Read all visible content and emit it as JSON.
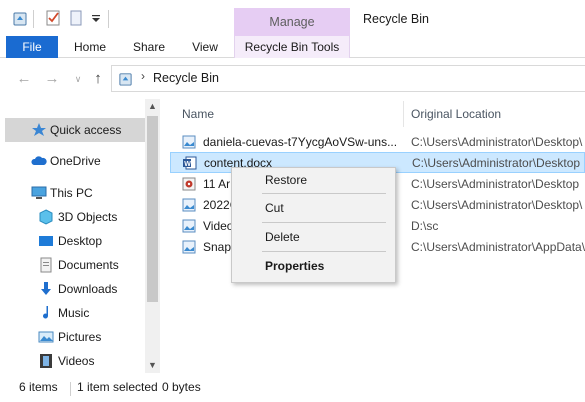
{
  "window": {
    "title": "Recycle Bin",
    "contextual_tab_group": "Manage"
  },
  "ribbon": {
    "tabs": [
      "File",
      "Home",
      "Share",
      "View",
      "Recycle Bin Tools"
    ]
  },
  "address": {
    "location": "Recycle Bin"
  },
  "nav_pane": {
    "items": [
      "Quick access",
      "OneDrive",
      "This PC",
      "3D Objects",
      "Desktop",
      "Documents",
      "Downloads",
      "Music",
      "Pictures",
      "Videos"
    ]
  },
  "columns": {
    "name": "Name",
    "original_location": "Original Location"
  },
  "files": [
    {
      "name": "daniela-cuevas-t7YycgAoVSw-uns...",
      "location": "C:\\Users\\Administrator\\Desktop\\",
      "icon": "image-file-icon"
    },
    {
      "name": "content.docx",
      "location": "C:\\Users\\Administrator\\Desktop",
      "icon": "word-document-icon"
    },
    {
      "name": "11 Ar",
      "location": "C:\\Users\\Administrator\\Desktop",
      "icon": "media-file-icon"
    },
    {
      "name": "2022C",
      "location": "C:\\Users\\Administrator\\Desktop\\",
      "icon": "image-file-icon"
    },
    {
      "name": "Video",
      "location": "D:\\sc",
      "icon": "image-file-icon"
    },
    {
      "name": "Snap",
      "location": "C:\\Users\\Administrator\\AppData\\",
      "icon": "image-file-icon"
    }
  ],
  "context_menu": {
    "restore": "Restore",
    "cut": "Cut",
    "delete": "Delete",
    "properties": "Properties"
  },
  "status": {
    "item_count": "6 items",
    "selection": "1 item selected",
    "size": "0 bytes"
  },
  "colors": {
    "file_tab": "#1a6bd1",
    "manage_tab": "#e6cdf3",
    "selection": "#cce8ff",
    "quick_access_highlight": "#d6d6d6"
  }
}
